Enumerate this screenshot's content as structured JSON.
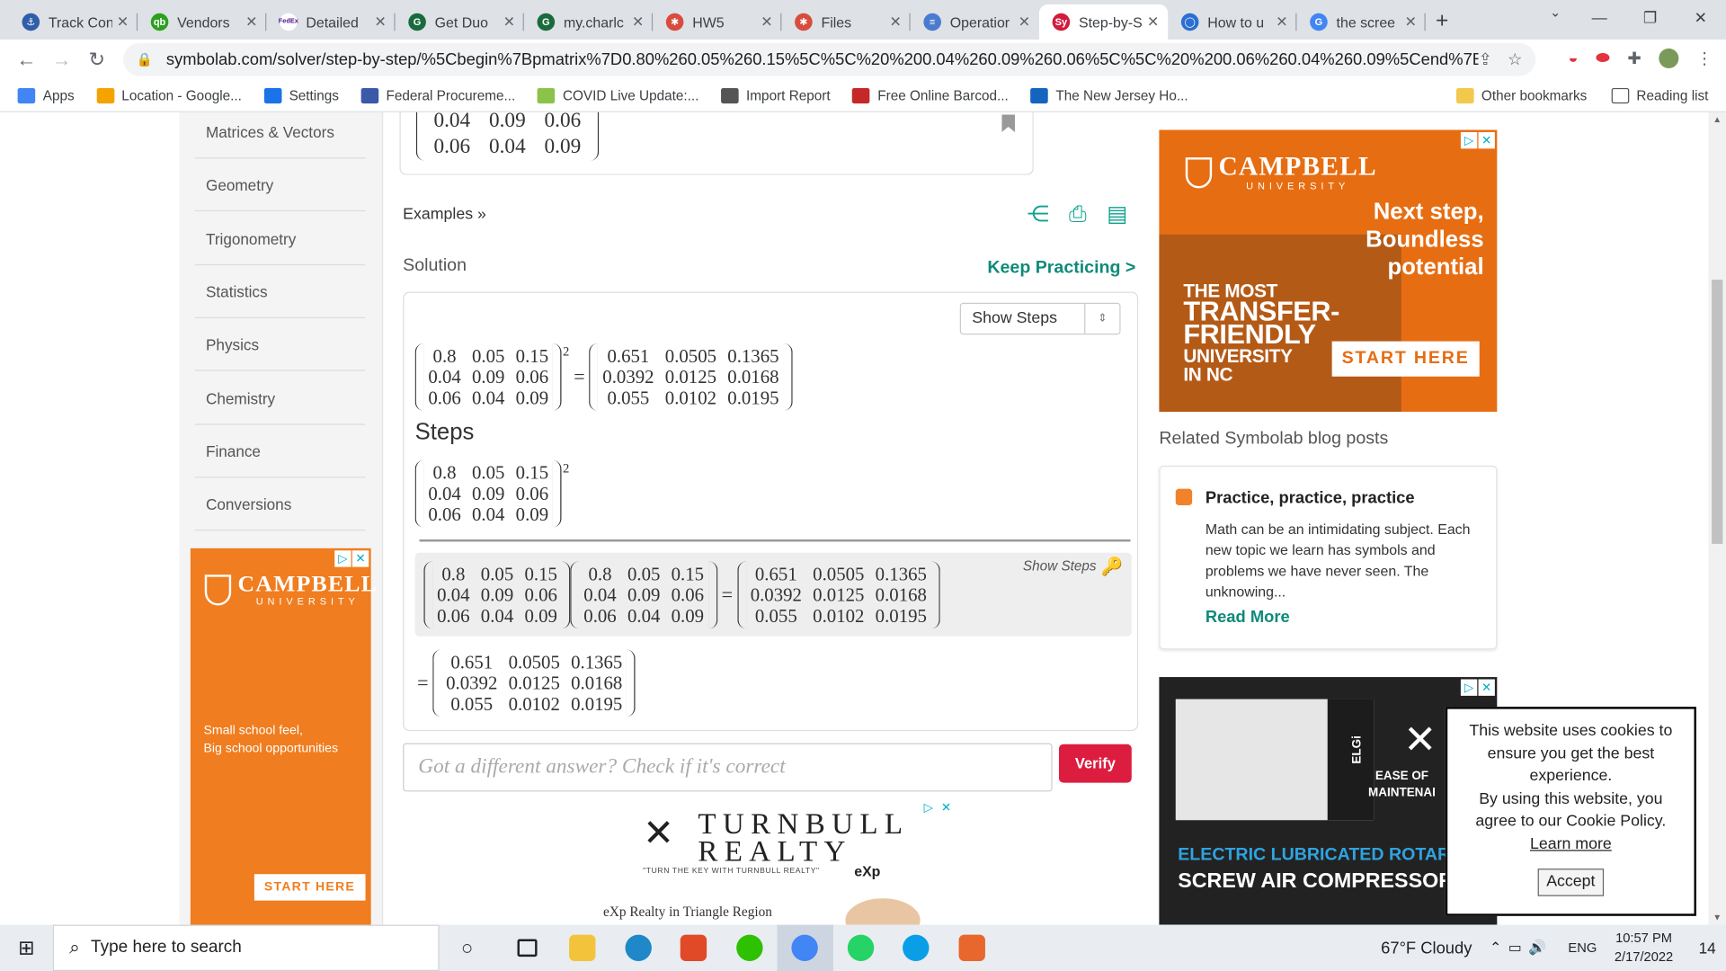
{
  "browser": {
    "tabs": [
      {
        "title": "Track Con",
        "color": "#2f5fa8",
        "glyph": "⚓",
        "active": false
      },
      {
        "title": "Vendors",
        "color": "#2ca01c",
        "glyph": "qb",
        "active": false
      },
      {
        "title": "Detailed",
        "color": "#ffffff",
        "glyph": "FedEx",
        "active": false
      },
      {
        "title": "Get Duo",
        "color": "#1a6b3c",
        "glyph": "G",
        "active": false
      },
      {
        "title": "my.charlc",
        "color": "#1a6b3c",
        "glyph": "G",
        "active": false
      },
      {
        "title": "HW5",
        "color": "#d84c3e",
        "glyph": "✱",
        "active": false
      },
      {
        "title": "Files",
        "color": "#d84c3e",
        "glyph": "✱",
        "active": false
      },
      {
        "title": "Operatior",
        "color": "#4a7bd0",
        "glyph": "≡",
        "active": false
      },
      {
        "title": "Step-by-S",
        "color": "#d11c3d",
        "glyph": "Sy",
        "active": true
      },
      {
        "title": "How to u",
        "color": "#2a6fd1",
        "glyph": "◯",
        "active": false
      },
      {
        "title": "the scree",
        "color": "#4285f4",
        "glyph": "G",
        "active": false
      }
    ],
    "new_tab": "+",
    "url": "symbolab.com/solver/step-by-step/%5Cbegin%7Bpmatrix%7D0.80%260.05%260.15%5C%5C%20%200.04%260.09%260.06%5C%5C%20%200.06%260.04%260.09%5Cend%7Bpmatrix%7...",
    "bookmarks": [
      {
        "label": "Apps",
        "color": "#4285f4"
      },
      {
        "label": "Location - Google...",
        "color": "#f4a300"
      },
      {
        "label": "Settings",
        "color": "#1a73e8"
      },
      {
        "label": "Federal Procureme...",
        "color": "#3a5aa8"
      },
      {
        "label": "COVID Live Update:...",
        "color": "#8bc34a"
      },
      {
        "label": "Import Report",
        "color": "#555555"
      },
      {
        "label": "Free Online Barcod...",
        "color": "#c62828"
      },
      {
        "label": "The New Jersey Ho...",
        "color": "#1565c0"
      }
    ],
    "bookmarks_right": [
      "Other bookmarks",
      "Reading list"
    ]
  },
  "sidebar": {
    "items": [
      "Matrices & Vectors",
      "Geometry",
      "Trigonometry",
      "Statistics",
      "Physics",
      "Chemistry",
      "Finance",
      "Conversions"
    ]
  },
  "ads": {
    "campbell_name": "CAMPBELL",
    "campbell_sub": "UNIVERSITY",
    "left_line1": "Small school feel,",
    "left_line2": "Big school opportunities",
    "left_cta": "START HERE",
    "right_tag1": "Next step,",
    "right_tag2": "Boundless",
    "right_tag3": "potential",
    "right_t1": "THE MOST",
    "right_t2": "TRANSFER-",
    "right_t3": "FRIENDLY",
    "right_t4": "UNIVERSITY",
    "right_t5": "IN NC",
    "right_cta": "START HERE",
    "turnbull_1": "TURNBULL",
    "turnbull_2": "REALTY",
    "turnbull_tag": "\"TURN THE KEY WITH TURNBULL REALTY\"",
    "turnbull_exp": "eXp",
    "turnbull_region": "eXp Realty in Triangle Region",
    "elgi_brand": "ELGi",
    "elgi_ease1": "EASE OF",
    "elgi_ease2": "MAINTENAI",
    "elgi_line1": "ELECTRIC LUBRICATED ROTARY",
    "elgi_line2": "SCREW AIR COMPRESSOR"
  },
  "main": {
    "examples": "Examples »",
    "solution_label": "Solution",
    "keep_practicing": "Keep Practicing >",
    "show_steps_select": "Show Steps",
    "steps_title": "Steps",
    "show_steps_link": "Show Steps",
    "exponent": "2",
    "matrix_A": [
      [
        "0.8",
        "0.05",
        "0.15"
      ],
      [
        "0.04",
        "0.09",
        "0.06"
      ],
      [
        "0.06",
        "0.04",
        "0.09"
      ]
    ],
    "matrix_result": [
      [
        "0.651",
        "0.0505",
        "0.1365"
      ],
      [
        "0.0392",
        "0.0125",
        "0.0168"
      ],
      [
        "0.055",
        "0.0102",
        "0.0195"
      ]
    ],
    "top_partial": [
      [
        "0.04",
        "0.09",
        "0.06"
      ],
      [
        "0.06",
        "0.04",
        "0.09"
      ]
    ],
    "verify_placeholder": "Got a different answer? Check if it's correct",
    "verify_button": "Verify"
  },
  "related": {
    "heading": "Related Symbolab blog posts",
    "post_title": "Practice, practice, practice",
    "post_body": "Math can be an intimidating subject. Each new topic we learn has symbols and problems we have never seen. The unknowing...",
    "read_more": "Read More"
  },
  "cookie": {
    "text1": "This website uses cookies to ensure you get the best experience.",
    "text2": "By using this website, you agree to our Cookie Policy.",
    "learn_more": "Learn more",
    "accept": "Accept"
  },
  "taskbar": {
    "search_placeholder": "Type here to search",
    "weather": "67°F Cloudy",
    "lang": "ENG",
    "time": "10:57 PM",
    "date": "2/17/2022",
    "notifications": "14",
    "apps": [
      {
        "name": "task-view",
        "color": "#222222"
      },
      {
        "name": "file-explorer",
        "color": "#f3c33b"
      },
      {
        "name": "edge",
        "color": "#1e88c8"
      },
      {
        "name": "office",
        "color": "#e04a26"
      },
      {
        "name": "wechat",
        "color": "#2dc100"
      },
      {
        "name": "chrome",
        "color": "#4285f4"
      },
      {
        "name": "whatsapp",
        "color": "#25d366"
      },
      {
        "name": "skype",
        "color": "#0a9ee6"
      },
      {
        "name": "snipping",
        "color": "#e8672c"
      }
    ]
  }
}
